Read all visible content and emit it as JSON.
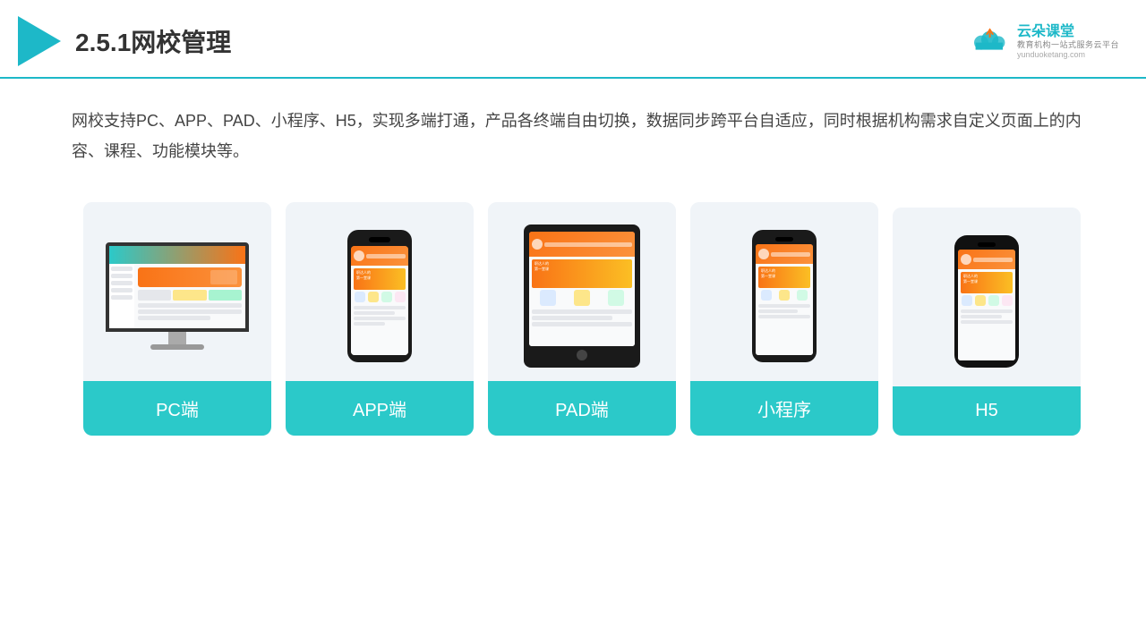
{
  "header": {
    "title": "2.5.1网校管理",
    "logo_name": "云朵课堂",
    "logo_url": "yunduoketang.com",
    "logo_tagline": "教育机构一站",
    "logo_tagline2": "式服务云平台"
  },
  "description": {
    "text": "网校支持PC、APP、PAD、小程序、H5，实现多端打通，产品各终端自由切换，数据同步跨平台自适应，同时根据机构需求自定义页面上的内容、课程、功能模块等。"
  },
  "cards": [
    {
      "label": "PC端",
      "type": "pc"
    },
    {
      "label": "APP端",
      "type": "phone"
    },
    {
      "label": "PAD端",
      "type": "tablet"
    },
    {
      "label": "小程序",
      "type": "miniphone"
    },
    {
      "label": "H5",
      "type": "h5phone"
    }
  ],
  "colors": {
    "accent": "#2bc9c9",
    "orange": "#f97316",
    "bg_card": "#f0f4f8"
  }
}
